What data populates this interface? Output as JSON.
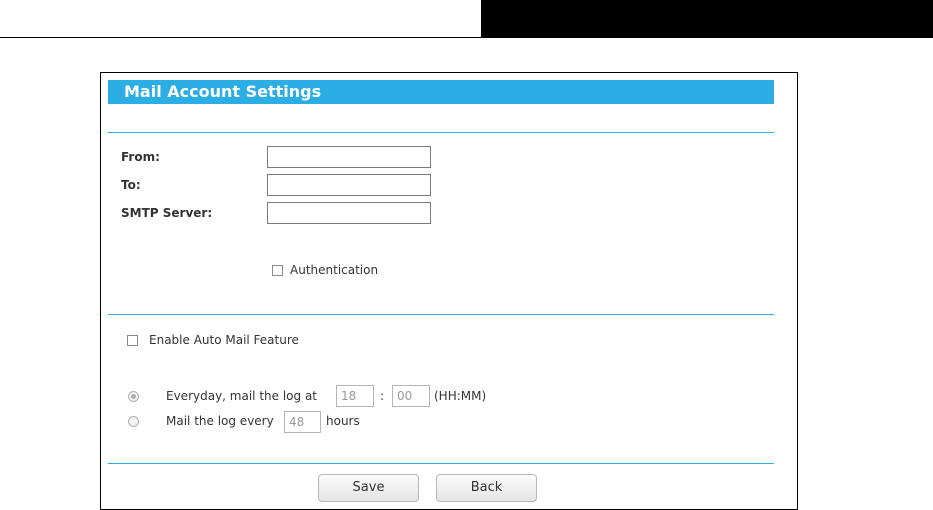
{
  "panel": {
    "title": "Mail Account Settings"
  },
  "account": {
    "from_label": "From:",
    "from_value": "",
    "to_label": "To:",
    "to_value": "",
    "smtp_label": "SMTP Server:",
    "smtp_value": "",
    "authentication_label": "Authentication",
    "authentication_checked": false
  },
  "auto_mail": {
    "enable_label": "Enable Auto Mail Feature",
    "enable_checked": false,
    "everyday_prefix": "Everyday, mail the log at",
    "everyday_hour": "18",
    "time_separator": ":",
    "everyday_minute": "00",
    "time_format": "(HH:MM)",
    "every_prefix": "Mail the log every",
    "every_hours": "48",
    "every_suffix": "hours",
    "selected_option": "everyday"
  },
  "buttons": {
    "save_label": "Save",
    "back_label": "Back"
  },
  "colors": {
    "accent": "#2aaee3",
    "header_bar": "#000000"
  }
}
